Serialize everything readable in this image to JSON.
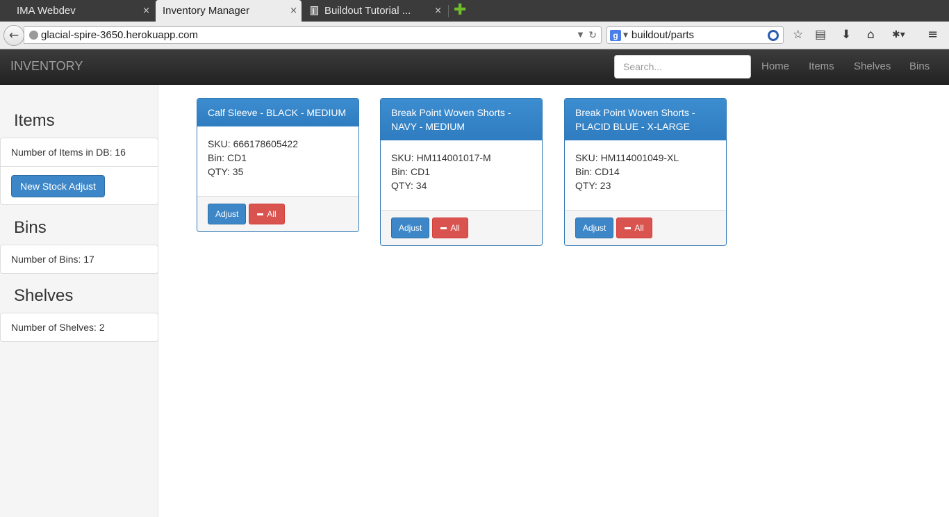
{
  "browser": {
    "tabs": [
      {
        "title": "IMA Webdev"
      },
      {
        "title": "Inventory Manager"
      },
      {
        "title": "Buildout Tutorial ..."
      }
    ],
    "close_glyph": "×",
    "new_tab_glyph": "✚",
    "url": "glacial-spire-3650.herokuapp.com",
    "search_engine_glyph": "g",
    "search_query": "buildout/parts",
    "toolbar_icons": [
      "bookmark-star-icon",
      "reading-list-icon",
      "download-icon",
      "home-icon",
      "addon-icon",
      "menu-icon"
    ]
  },
  "app": {
    "brand": "INVENTORY",
    "search_placeholder": "Search...",
    "nav": [
      "Home",
      "Items",
      "Shelves",
      "Bins"
    ]
  },
  "sidebar": {
    "items_heading": "Items",
    "items_count_text": "Number of Items in DB: 16",
    "new_stock_button": "New Stock Adjust",
    "bins_heading": "Bins",
    "bins_count_text": "Number of Bins: 17",
    "shelves_heading": "Shelves",
    "shelves_count_text": "Number of Shelves: 2"
  },
  "cards": [
    {
      "title_line1": "Calf Sleeve - BLACK - MEDIUM",
      "title_line2": "",
      "sku": "SKU: 666178605422",
      "bin": "Bin: CD1",
      "qty": "QTY: 35",
      "adjust": "Adjust",
      "all": "All"
    },
    {
      "title_line1": "Break Point Woven Shorts -",
      "title_line2": "NAVY - MEDIUM",
      "sku": "SKU: HM114001017-M",
      "bin": "Bin: CD1",
      "qty": "QTY: 34",
      "adjust": "Adjust",
      "all": "All"
    },
    {
      "title_line1": "Break Point Woven Shorts -",
      "title_line2": "PLACID BLUE - X-LARGE",
      "sku": "SKU: HM114001049-XL",
      "bin": "Bin: CD14",
      "qty": "QTY: 23",
      "adjust": "Adjust",
      "all": "All"
    }
  ],
  "colors": {
    "primary": "#337ab7",
    "danger": "#d9534f",
    "navbar": "#222222"
  }
}
